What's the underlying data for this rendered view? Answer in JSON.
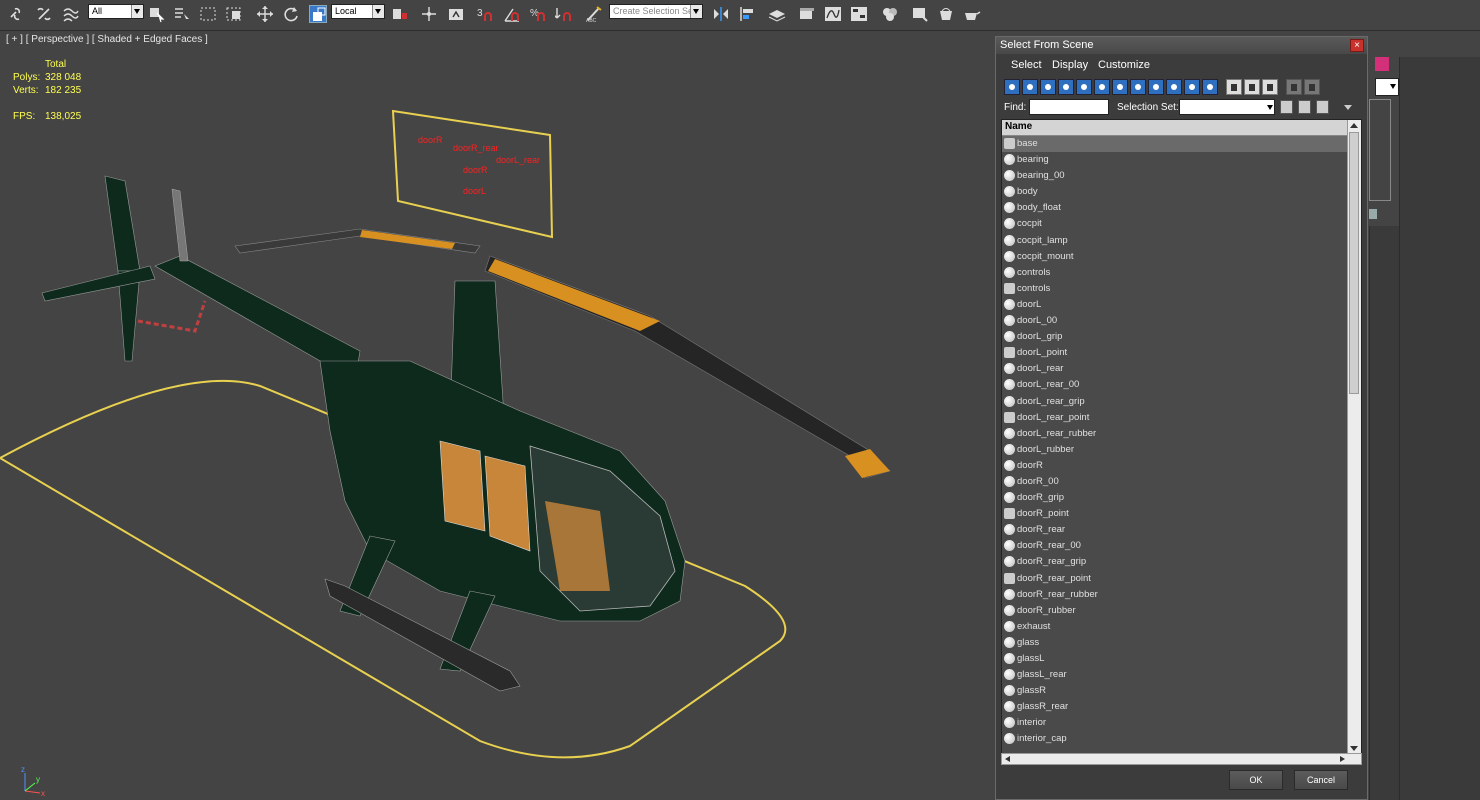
{
  "toolbar": {
    "filter_dropdown": "All",
    "coord_dropdown": "Local",
    "selection_set_dropdown": "Create Selection Se",
    "icons": [
      "link-icon",
      "unlink-icon",
      "bind-spacewarp-icon",
      "select-object-icon",
      "select-by-name-icon",
      "rect-region-icon",
      "window-crossing-icon",
      "move-icon",
      "rotate-icon",
      "scale-icon",
      "pivot-icon",
      "select-manipulate-icon",
      "keyboard-shortcut-icon",
      "snap-3d-icon",
      "angle-snap-icon",
      "percent-snap-icon",
      "spinner-snap-icon",
      "edit-named-sets-icon",
      "mirror-icon",
      "align-icon",
      "layer-icon",
      "graphite-icon",
      "curve-editor-icon",
      "schematic-icon",
      "material-editor-icon",
      "render-setup-icon",
      "rendered-frame-icon",
      "render-icon"
    ]
  },
  "viewport": {
    "label": "[ + ] [ Perspective ] [ Shaded + Edged Faces ]",
    "stats": {
      "total_label": "Total",
      "polys_label": "Polys:",
      "polys_value": "328 048",
      "verts_label": "Verts:",
      "verts_value": "182 235",
      "fps_label": "FPS:",
      "fps_value": "138,025"
    },
    "panel_labels": [
      "doorR",
      "doorR_rear",
      "doorL_rear",
      "doorR",
      "doorL"
    ],
    "axis_labels": {
      "x": "x",
      "y": "y",
      "z": "z"
    }
  },
  "dialog": {
    "title": "Select From Scene",
    "close_label": "×",
    "menu": [
      "Select",
      "Display",
      "Customize"
    ],
    "find_label": "Find:",
    "find_value": "",
    "selection_set_label": "Selection Set:",
    "selection_set_value": "",
    "column_header": "Name",
    "items": [
      {
        "name": "base",
        "icon": "camera",
        "selected": true
      },
      {
        "name": "bearing",
        "icon": "sphere"
      },
      {
        "name": "bearing_00",
        "icon": "sphere"
      },
      {
        "name": "body",
        "icon": "sphere"
      },
      {
        "name": "body_float",
        "icon": "sphere"
      },
      {
        "name": "cocpit",
        "icon": "sphere"
      },
      {
        "name": "cocpit_lamp",
        "icon": "sphere"
      },
      {
        "name": "cocpit_mount",
        "icon": "sphere"
      },
      {
        "name": "controls",
        "icon": "sphere"
      },
      {
        "name": "controls",
        "icon": "camera"
      },
      {
        "name": "doorL",
        "icon": "sphere"
      },
      {
        "name": "doorL_00",
        "icon": "sphere"
      },
      {
        "name": "doorL_grip",
        "icon": "sphere"
      },
      {
        "name": "doorL_point",
        "icon": "camera"
      },
      {
        "name": "doorL_rear",
        "icon": "sphere"
      },
      {
        "name": "doorL_rear_00",
        "icon": "sphere"
      },
      {
        "name": "doorL_rear_grip",
        "icon": "sphere"
      },
      {
        "name": "doorL_rear_point",
        "icon": "camera"
      },
      {
        "name": "doorL_rear_rubber",
        "icon": "sphere"
      },
      {
        "name": "doorL_rubber",
        "icon": "sphere"
      },
      {
        "name": "doorR",
        "icon": "sphere"
      },
      {
        "name": "doorR_00",
        "icon": "sphere"
      },
      {
        "name": "doorR_grip",
        "icon": "sphere"
      },
      {
        "name": "doorR_point",
        "icon": "camera"
      },
      {
        "name": "doorR_rear",
        "icon": "sphere"
      },
      {
        "name": "doorR_rear_00",
        "icon": "sphere"
      },
      {
        "name": "doorR_rear_grip",
        "icon": "sphere"
      },
      {
        "name": "doorR_rear_point",
        "icon": "camera"
      },
      {
        "name": "doorR_rear_rubber",
        "icon": "sphere"
      },
      {
        "name": "doorR_rubber",
        "icon": "sphere"
      },
      {
        "name": "exhaust",
        "icon": "sphere"
      },
      {
        "name": "glass",
        "icon": "sphere"
      },
      {
        "name": "glassL",
        "icon": "sphere"
      },
      {
        "name": "glassL_rear",
        "icon": "sphere"
      },
      {
        "name": "glassR",
        "icon": "sphere"
      },
      {
        "name": "glassR_rear",
        "icon": "sphere"
      },
      {
        "name": "interior",
        "icon": "sphere"
      },
      {
        "name": "interior_cap",
        "icon": "sphere"
      }
    ],
    "ok_label": "OK",
    "cancel_label": "Cancel"
  },
  "colors": {
    "accent_magenta": "#d4307a",
    "stats_yellow": "#ffff50",
    "outline_yellow": "#f0d040"
  }
}
